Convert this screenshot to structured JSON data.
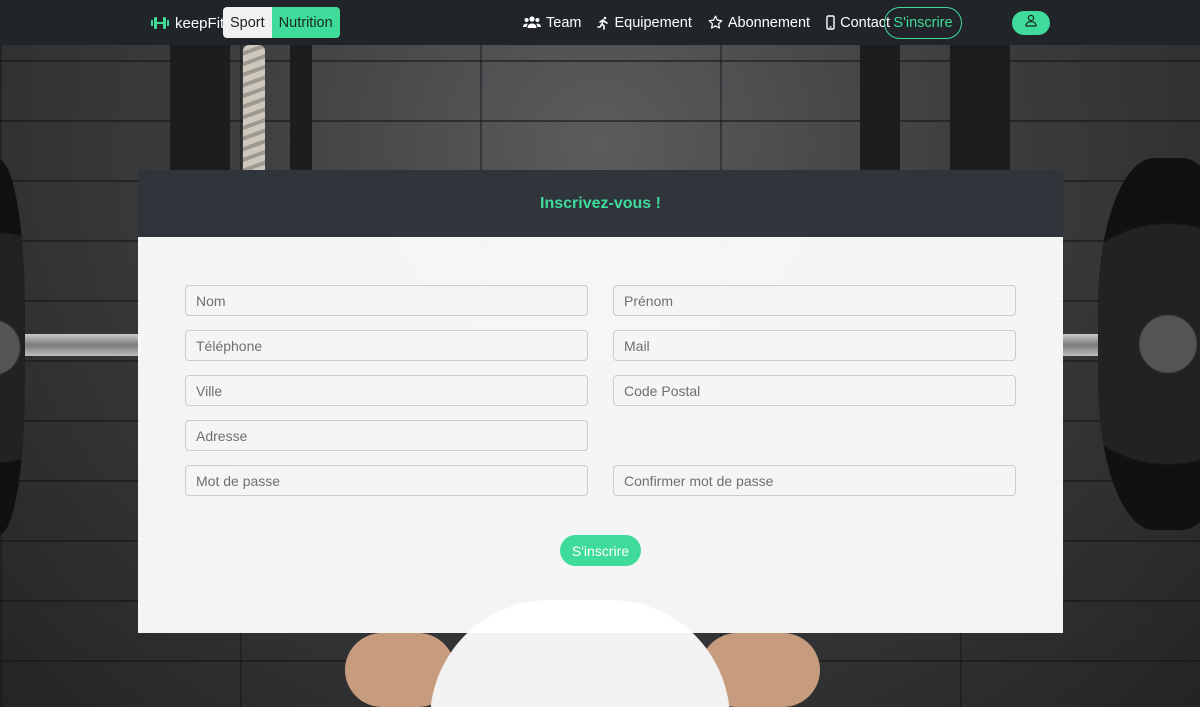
{
  "navbar": {
    "brand": {
      "label": "keepFit",
      "icon": "dumbbell-icon"
    },
    "segments": [
      {
        "label": "Sport",
        "active": false
      },
      {
        "label": "Nutrition",
        "active": true
      }
    ],
    "links": [
      {
        "label": "Team",
        "icon": "users-icon"
      },
      {
        "label": "Equipement",
        "icon": "running-icon"
      },
      {
        "label": "Abonnement",
        "icon": "star-icon"
      },
      {
        "label": "Contact",
        "icon": "smartphone-icon"
      }
    ],
    "signup_label": "S'inscrire",
    "user_icon": "user-icon"
  },
  "form": {
    "title": "Inscrivez-vous !",
    "fields": {
      "nom": {
        "placeholder": "Nom",
        "value": ""
      },
      "prenom": {
        "placeholder": "Prénom",
        "value": ""
      },
      "telephone": {
        "placeholder": "Téléphone",
        "value": ""
      },
      "mail": {
        "placeholder": "Mail",
        "value": ""
      },
      "ville": {
        "placeholder": "Ville",
        "value": ""
      },
      "code_postal": {
        "placeholder": "Code Postal",
        "value": ""
      },
      "adresse": {
        "placeholder": "Adresse",
        "value": ""
      },
      "mot_de_passe": {
        "placeholder": "Mot de passe",
        "value": ""
      },
      "confirmer": {
        "placeholder": "Confirmer mot de passe",
        "value": ""
      }
    },
    "submit_label": "S'inscrire"
  },
  "colors": {
    "accent": "#3fdb9a",
    "navbar_bg": "#212529",
    "card_header_bg": "#30353c"
  }
}
